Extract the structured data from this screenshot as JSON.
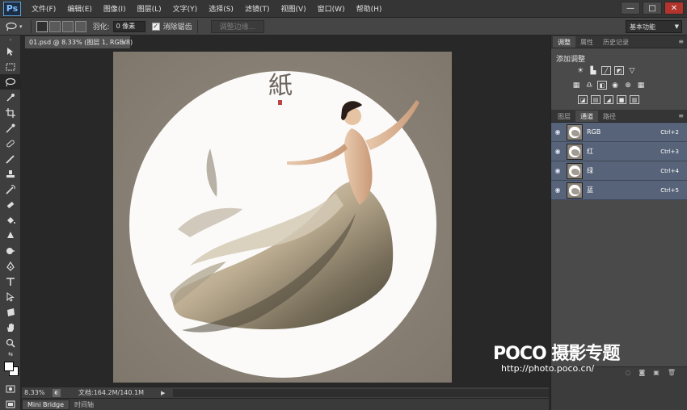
{
  "app": {
    "logo": "Ps"
  },
  "menu": [
    "文件(F)",
    "编辑(E)",
    "图像(I)",
    "图层(L)",
    "文字(Y)",
    "选择(S)",
    "滤镜(T)",
    "视图(V)",
    "窗口(W)",
    "帮助(H)"
  ],
  "window_controls": {
    "minimize": "—",
    "maximize": "□",
    "close": "✕"
  },
  "options": {
    "feather_label": "羽化:",
    "feather_value": "0 像素",
    "antialias_label": "消除锯齿",
    "antialias_checked": true,
    "refine_edge": "调整边缘...",
    "workspace": "基本功能"
  },
  "document": {
    "tab_title": "01.psd @ 8.33% (图层 1, RGB/8)",
    "tab_close": "×",
    "artwork_title": "紙"
  },
  "status": {
    "zoom": "8.33%",
    "doc_info": "文档:164.2M/140.1M",
    "arrow": "▶"
  },
  "bottom_tabs": [
    "Mini Bridge",
    "时间轴"
  ],
  "panels": {
    "top_tabs": [
      "调整",
      "属性",
      "历史记录"
    ],
    "adjustments_title": "添加调整",
    "layer_tabs": [
      "图层",
      "通道",
      "路径"
    ],
    "channels": [
      {
        "name": "RGB",
        "shortcut": "Ctrl+2"
      },
      {
        "name": "红",
        "shortcut": "Ctrl+3"
      },
      {
        "name": "绿",
        "shortcut": "Ctrl+4"
      },
      {
        "name": "蓝",
        "shortcut": "Ctrl+5"
      }
    ]
  },
  "watermark": {
    "brand": "POCO 摄影专题",
    "url": "http://photo.poco.cn/"
  },
  "colors": {
    "channel_row": "#576378",
    "paper": "#8c8478",
    "accent": "#5ba0d8"
  }
}
